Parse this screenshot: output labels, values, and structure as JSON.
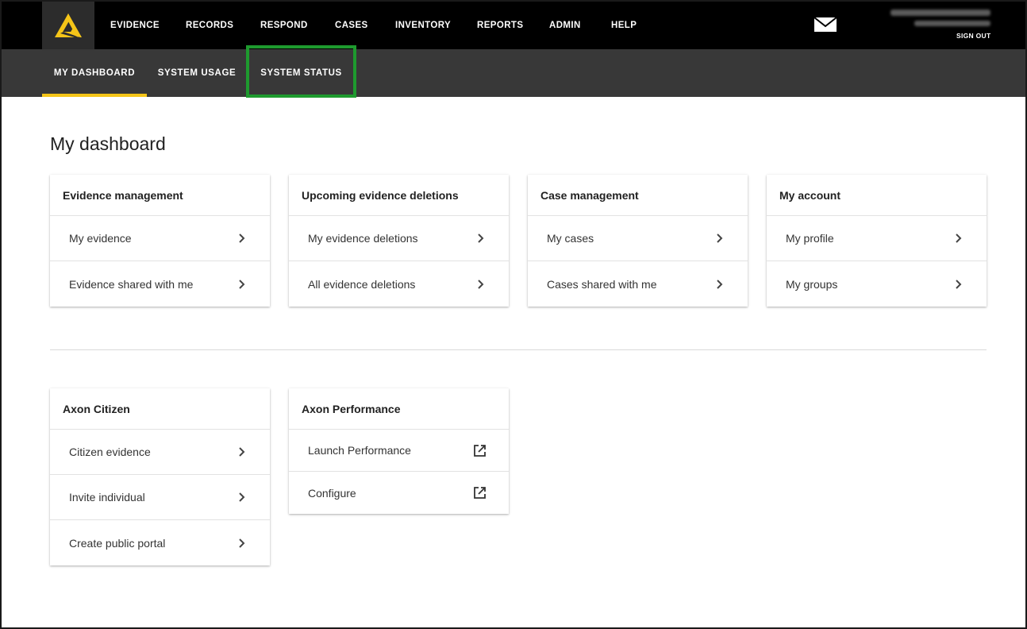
{
  "topnav": {
    "items": [
      {
        "label": "EVIDENCE"
      },
      {
        "label": "RECORDS"
      },
      {
        "label": "RESPOND"
      },
      {
        "label": "CASES"
      },
      {
        "label": "INVENTORY"
      },
      {
        "label": "REPORTS"
      },
      {
        "label": "ADMIN"
      },
      {
        "label": "HELP"
      }
    ],
    "sign_out_label": "SIGN OUT"
  },
  "subnav": {
    "tabs": [
      {
        "label": "MY DASHBOARD",
        "active": true
      },
      {
        "label": "SYSTEM USAGE",
        "active": false
      },
      {
        "label": "SYSTEM STATUS",
        "active": false,
        "highlighted": true
      }
    ]
  },
  "page": {
    "title": "My dashboard"
  },
  "cards": {
    "evidence_management": {
      "title": "Evidence management",
      "rows": [
        {
          "label": "My evidence",
          "icon": "chevron-right-icon"
        },
        {
          "label": "Evidence shared with me",
          "icon": "chevron-right-icon"
        }
      ]
    },
    "upcoming_deletions": {
      "title": "Upcoming evidence deletions",
      "rows": [
        {
          "label": "My evidence deletions",
          "icon": "chevron-right-icon"
        },
        {
          "label": "All evidence deletions",
          "icon": "chevron-right-icon"
        }
      ]
    },
    "case_management": {
      "title": "Case management",
      "rows": [
        {
          "label": "My cases",
          "icon": "chevron-right-icon"
        },
        {
          "label": "Cases shared with me",
          "icon": "chevron-right-icon"
        }
      ]
    },
    "my_account": {
      "title": "My account",
      "rows": [
        {
          "label": "My profile",
          "icon": "chevron-right-icon"
        },
        {
          "label": "My groups",
          "icon": "chevron-right-icon"
        }
      ]
    },
    "axon_citizen": {
      "title": "Axon Citizen",
      "rows": [
        {
          "label": "Citizen evidence",
          "icon": "chevron-right-icon"
        },
        {
          "label": "Invite individual",
          "icon": "chevron-right-icon"
        },
        {
          "label": "Create public portal",
          "icon": "chevron-right-icon"
        }
      ]
    },
    "axon_performance": {
      "title": "Axon Performance",
      "rows": [
        {
          "label": "Launch Performance",
          "icon": "external-link-icon"
        },
        {
          "label": "Configure",
          "icon": "external-link-icon"
        }
      ]
    }
  },
  "colors": {
    "topnav_bg": "#000000",
    "subnav_bg": "#383838",
    "active_tab_underline": "#f5c518",
    "highlight_box": "#1e9a2e",
    "logo_yellow": "#f5c518"
  }
}
